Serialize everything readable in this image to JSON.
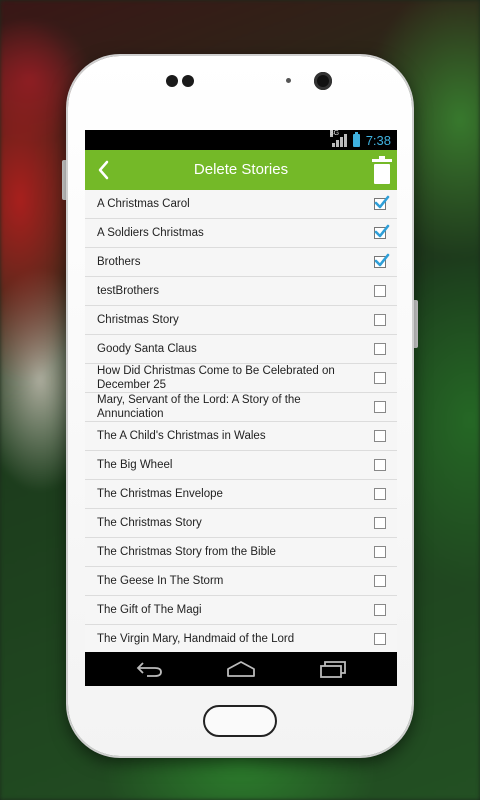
{
  "status": {
    "network": "3G",
    "time": "7:38"
  },
  "header": {
    "title": "Delete Stories"
  },
  "stories": [
    {
      "title": "A Christmas Carol",
      "checked": true
    },
    {
      "title": "A Soldiers Christmas",
      "checked": true
    },
    {
      "title": "Brothers",
      "checked": true
    },
    {
      "title": "testBrothers",
      "checked": false
    },
    {
      "title": "Christmas Story",
      "checked": false
    },
    {
      "title": "Goody Santa Claus",
      "checked": false
    },
    {
      "title": "How Did Christmas Come to Be Celebrated on December 25",
      "checked": false
    },
    {
      "title": "Mary, Servant of the Lord: A Story of the Annunciation",
      "checked": false
    },
    {
      "title": "The A Child's Christmas in Wales",
      "checked": false
    },
    {
      "title": "The Big Wheel",
      "checked": false
    },
    {
      "title": "The Christmas Envelope",
      "checked": false
    },
    {
      "title": "The Christmas Story",
      "checked": false
    },
    {
      "title": "The Christmas Story from the Bible",
      "checked": false
    },
    {
      "title": "The Geese In The Storm",
      "checked": false
    },
    {
      "title": "The Gift of The Magi",
      "checked": false
    },
    {
      "title": "The Virgin Mary, Handmaid of the Lord",
      "checked": false
    }
  ],
  "colors": {
    "accent_green": "#74b928",
    "check_blue": "#2f9fd8",
    "status_blue": "#3fb2e0"
  },
  "icons": {
    "back": "chevron-left-icon",
    "delete": "trash-icon",
    "nav_back": "back-arrow-icon",
    "nav_home": "home-icon",
    "nav_recents": "recents-icon"
  }
}
